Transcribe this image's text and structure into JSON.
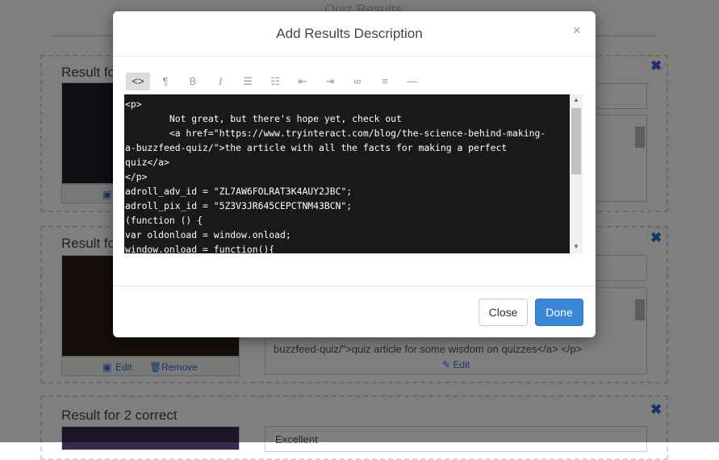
{
  "background": {
    "page_title": "Quiz Results",
    "cards": [
      {
        "title": "Result for",
        "field": "",
        "description": "",
        "edit_label": "Edit",
        "remove_label": "Remove"
      },
      {
        "title": "Result for",
        "field": "",
        "description": "buzzfeed-quiz/\">quiz article for some wisdom on quizzes</a> </p>",
        "edit_label": "Edit",
        "remove_label": "Remove"
      },
      {
        "title": "Result for 2 correct",
        "field": "Excellent",
        "description": "",
        "edit_label": "Edit",
        "remove_label": "Remove"
      }
    ],
    "desc_edit_label": "Edit"
  },
  "modal": {
    "title": "Add Results Description",
    "close_icon": "×",
    "toolbar": [
      {
        "name": "code-view-icon",
        "glyph": "<>"
      },
      {
        "name": "paragraph-icon",
        "glyph": "¶"
      },
      {
        "name": "bold-icon",
        "glyph": "B"
      },
      {
        "name": "italic-icon",
        "glyph": "I"
      },
      {
        "name": "bullet-list-icon",
        "glyph": "☰"
      },
      {
        "name": "numbered-list-icon",
        "glyph": "☷"
      },
      {
        "name": "outdent-icon",
        "glyph": "⇤"
      },
      {
        "name": "indent-icon",
        "glyph": "⇥"
      },
      {
        "name": "link-icon",
        "glyph": "∞"
      },
      {
        "name": "align-icon",
        "glyph": "≡"
      },
      {
        "name": "horizontal-rule-icon",
        "glyph": "—"
      }
    ],
    "code": "<p>\n        Not great, but there's hope yet, check out\n        <a href=\"https://www.tryinteract.com/blog/the-science-behind-making-\na-buzzfeed-quiz/\">the article with all the facts for making a perfect\nquiz</a>\n</p>\nadroll_adv_id = \"ZL7AW6FOLRAT3K4AUY2JBC\";\nadroll_pix_id = \"5Z3V3JR645CEPCTNM43BCN\";\n(function () {\nvar oldonload = window.onload;\nwindow.onload = function(){",
    "close_button": "Close",
    "done_button": "Done"
  }
}
